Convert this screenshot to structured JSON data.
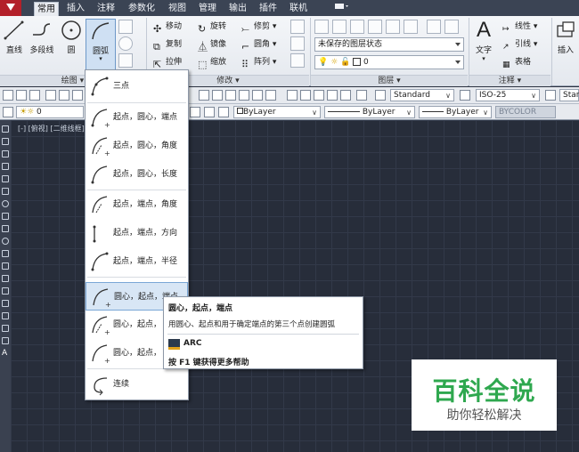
{
  "ribbon_tabs": [
    "常用",
    "插入",
    "注释",
    "参数化",
    "视图",
    "管理",
    "输出",
    "插件",
    "联机"
  ],
  "active_tab": "常用",
  "draw_panel": {
    "title": "绘图",
    "line": "直线",
    "polyline": "多段线",
    "circle": "圆",
    "arc": "圆弧"
  },
  "modify_panel": {
    "title": "修改",
    "move": "移动",
    "rotate": "旋转",
    "trim": "修剪",
    "copy": "复制",
    "mirror": "镜像",
    "fillet": "圆角",
    "stretch": "拉伸",
    "scale": "缩放",
    "array": "阵列"
  },
  "layers_panel": {
    "title": "图层",
    "layer_state": "未保存的图层状态",
    "current_layer": "0"
  },
  "annotation_panel": {
    "title": "注释",
    "text": "文字",
    "linear": "线性",
    "leader": "引线",
    "table": "表格"
  },
  "insert_panel": {
    "insert": "插入"
  },
  "toolbar1": {
    "text_style": "Standard",
    "dim_style": "ISO-25",
    "table_style": "Stan"
  },
  "toolbar2": {
    "layer": "0",
    "color": "ByLayer",
    "linetype": "ByLayer",
    "lineweight": "ByLayer",
    "plotstyle": "BYCOLOR"
  },
  "viewport_label": "[-] [俯视] [二维线框]",
  "arc_menu": {
    "items": [
      "三点",
      "起点，圆心，端点",
      "起点，圆心，角度",
      "起点，圆心，长度",
      "起点，端点，角度",
      "起点，端点，方向",
      "起点，端点，半径",
      "圆心，起点，端点",
      "圆心，起点，",
      "圆心，起点，",
      "连续"
    ],
    "hovered_index": 7
  },
  "tooltip": {
    "title": "圆心，起点，端点",
    "description": "用圆心、起点和用于确定端点的第三个点创建圆弧",
    "command": "ARC",
    "help": "按 F1 键获得更多帮助"
  },
  "watermark": {
    "title": "百科全说",
    "subtitle": "助你轻松解决"
  },
  "colors": {
    "canvas": "#272d3a",
    "app_button": "#b3202a",
    "hover": "#d8e6f5",
    "watermark_green": "#2fa84f"
  }
}
